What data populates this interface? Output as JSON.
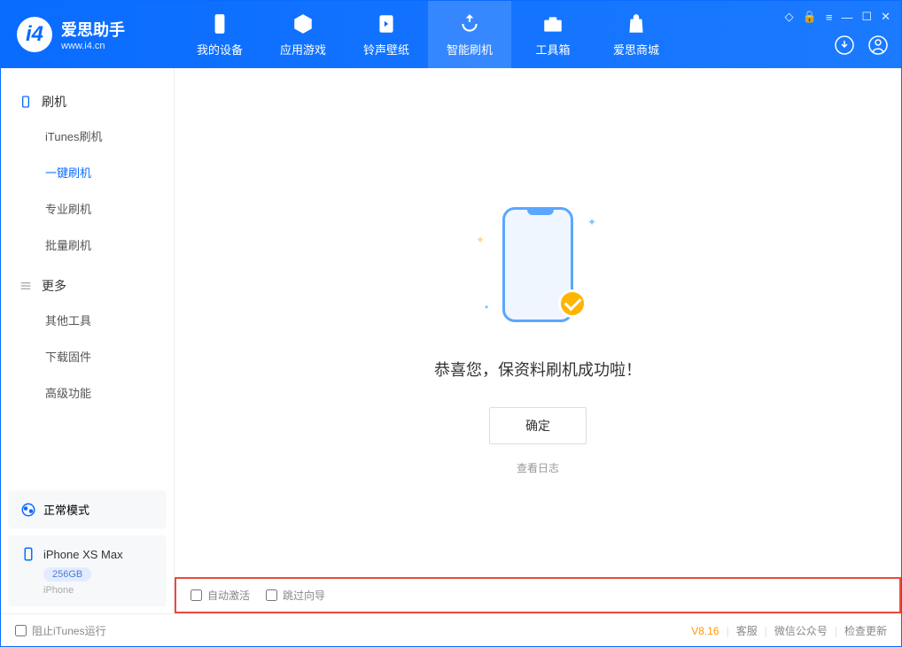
{
  "app": {
    "name": "爱思助手",
    "url": "www.i4.cn"
  },
  "nav": {
    "my_device": "我的设备",
    "apps_games": "应用游戏",
    "ringtones": "铃声壁纸",
    "smart_flash": "智能刷机",
    "toolbox": "工具箱",
    "store": "爱思商城"
  },
  "sidebar": {
    "flash_header": "刷机",
    "itunes_flash": "iTunes刷机",
    "onekey_flash": "一键刷机",
    "pro_flash": "专业刷机",
    "batch_flash": "批量刷机",
    "more_header": "更多",
    "other_tools": "其他工具",
    "download_fw": "下载固件",
    "advanced": "高级功能",
    "mode_normal": "正常模式",
    "device_name": "iPhone XS Max",
    "device_storage": "256GB",
    "device_type": "iPhone"
  },
  "content": {
    "success_msg": "恭喜您，保资料刷机成功啦！",
    "confirm": "确定",
    "view_log": "查看日志"
  },
  "checks": {
    "auto_activate": "自动激活",
    "skip_guide": "跳过向导"
  },
  "footer": {
    "block_itunes": "阻止iTunes运行",
    "version": "V8.16",
    "support": "客服",
    "wechat": "微信公众号",
    "update": "检查更新"
  }
}
